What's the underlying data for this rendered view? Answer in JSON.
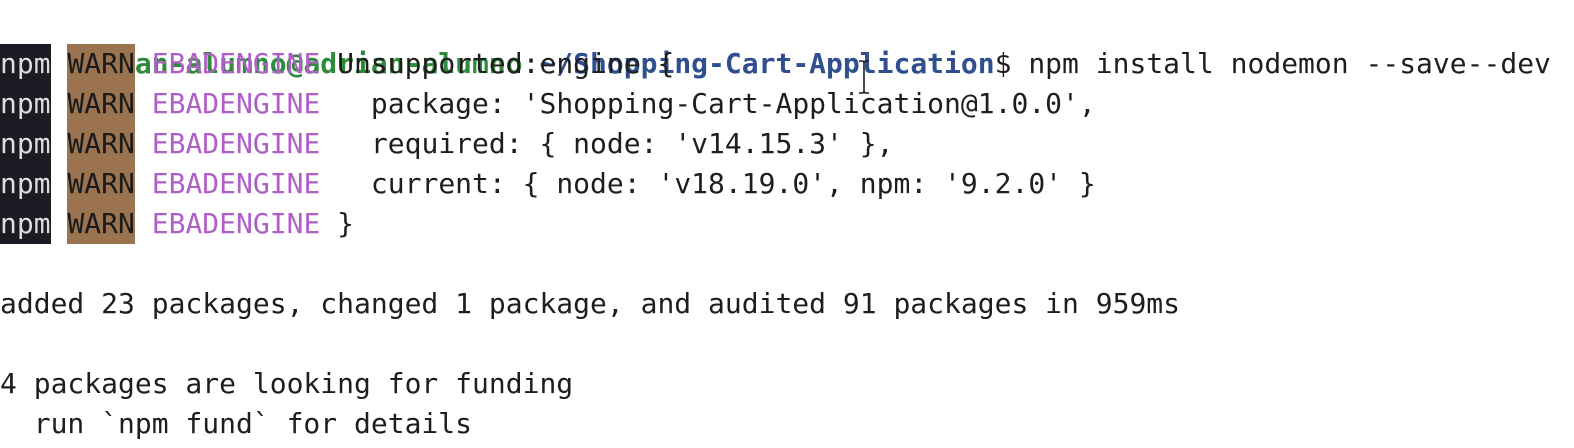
{
  "prompt": {
    "user_host": "adrian-alumno@adrian-alumno",
    "separator": ":",
    "path": "~/Shopping-Cart-Application",
    "symbol": "$",
    "command": " npm install nodemon --save--dev"
  },
  "warn_lines": [
    {
      "npm": "npm",
      "warn": "WARN",
      "code": "EBADENGINE",
      "text": " Unsupported engine {"
    },
    {
      "npm": "npm",
      "warn": "WARN",
      "code": "EBADENGINE",
      "text": "   package: 'Shopping-Cart-Application@1.0.0',"
    },
    {
      "npm": "npm",
      "warn": "WARN",
      "code": "EBADENGINE",
      "text": "   required: { node: 'v14.15.3' },"
    },
    {
      "npm": "npm",
      "warn": "WARN",
      "code": "EBADENGINE",
      "text": "   current: { node: 'v18.19.0', npm: '9.2.0' }"
    },
    {
      "npm": "npm",
      "warn": "WARN",
      "code": "EBADENGINE",
      "text": " }"
    }
  ],
  "output": {
    "summary": "added 23 packages, changed 1 package, and audited 91 packages in 959ms",
    "funding_line1": "4 packages are looking for funding",
    "funding_line2": "  run `npm fund` for details"
  },
  "colors": {
    "prompt_user": "#2e8b3c",
    "prompt_path": "#2f4f8f",
    "npm_bg": "#1b1b24",
    "warn_bg": "#9b7350",
    "ebadengine": "#b05fc6"
  },
  "icons": {
    "mouse_cursor": "ibeam-cursor-icon"
  }
}
